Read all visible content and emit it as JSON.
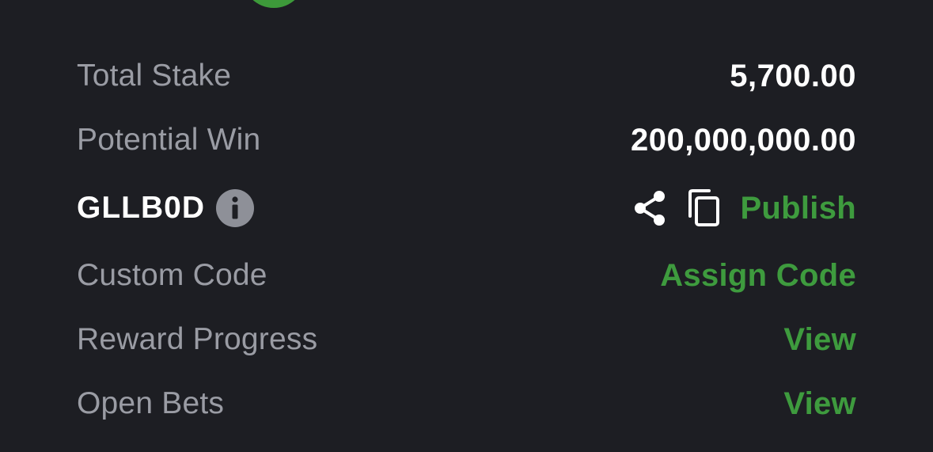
{
  "summary": {
    "total_stake_label": "Total Stake",
    "total_stake_value": "5,700.00",
    "potential_win_label": "Potential Win",
    "potential_win_value": "200,000,000.00"
  },
  "booking": {
    "code": "GLLB0D",
    "info_icon": "info-icon",
    "share_icon": "share-icon",
    "copy_icon": "copy-icon",
    "publish_label": "Publish"
  },
  "custom_code": {
    "label": "Custom Code",
    "action_label": "Assign Code"
  },
  "reward_progress": {
    "label": "Reward Progress",
    "action_label": "View"
  },
  "open_bets": {
    "label": "Open Bets",
    "action_label": "View"
  },
  "colors": {
    "background": "#1d1e23",
    "label_gray": "#9a9ca4",
    "accent_green": "#3e9b3e",
    "value_white": "#ffffff"
  }
}
